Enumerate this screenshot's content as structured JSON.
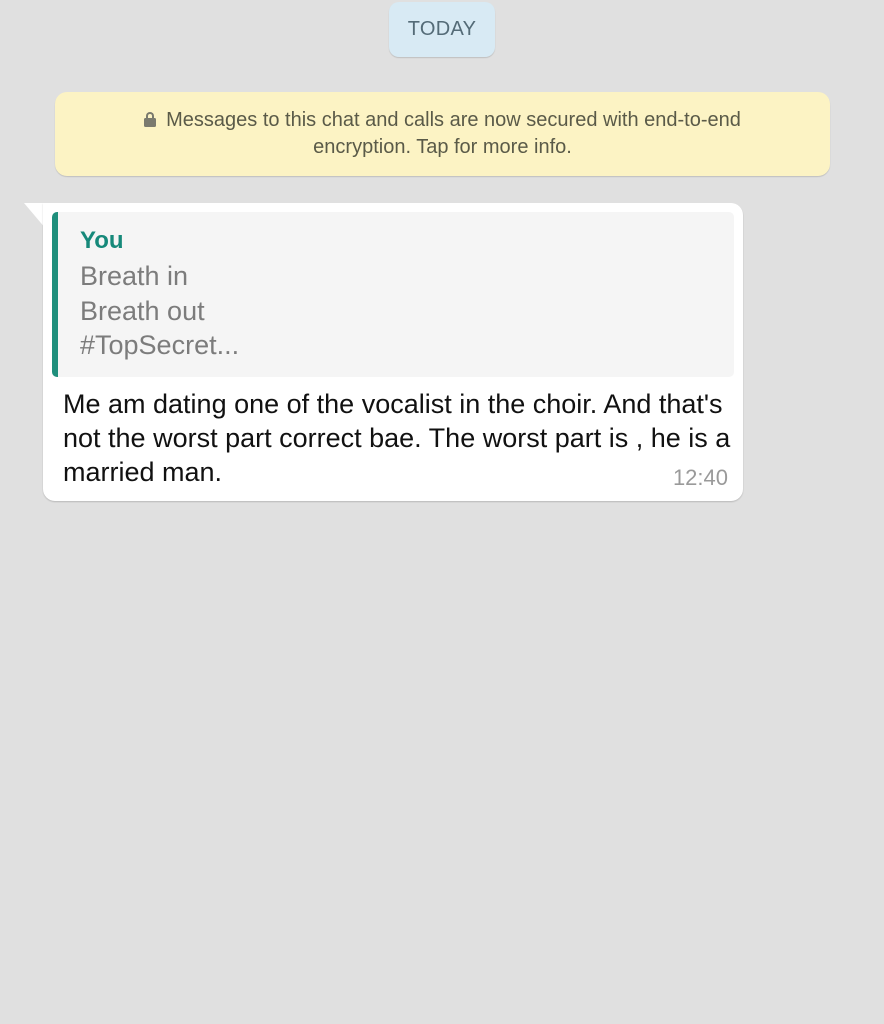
{
  "date_divider": {
    "label": "TODAY"
  },
  "encryption_notice": {
    "icon": "lock-icon",
    "line1": "Messages to this chat and calls are now secured with end-to-end",
    "line2": "encryption. Tap for more info."
  },
  "message": {
    "quoted": {
      "author": "You",
      "lines": [
        "Breath in",
        "Breath out",
        "#TopSecret..."
      ]
    },
    "text": "Me am dating one of the vocalist in the choir. And that's not the worst part correct bae. The worst part is , he is a married man.",
    "time": "12:40"
  },
  "colors": {
    "chat_background": "#e0e0e0",
    "date_pill": "#d8eaf4",
    "notice_background": "#fcf3c4",
    "quote_accent": "#1f8f7c",
    "quote_author": "#16897a"
  }
}
